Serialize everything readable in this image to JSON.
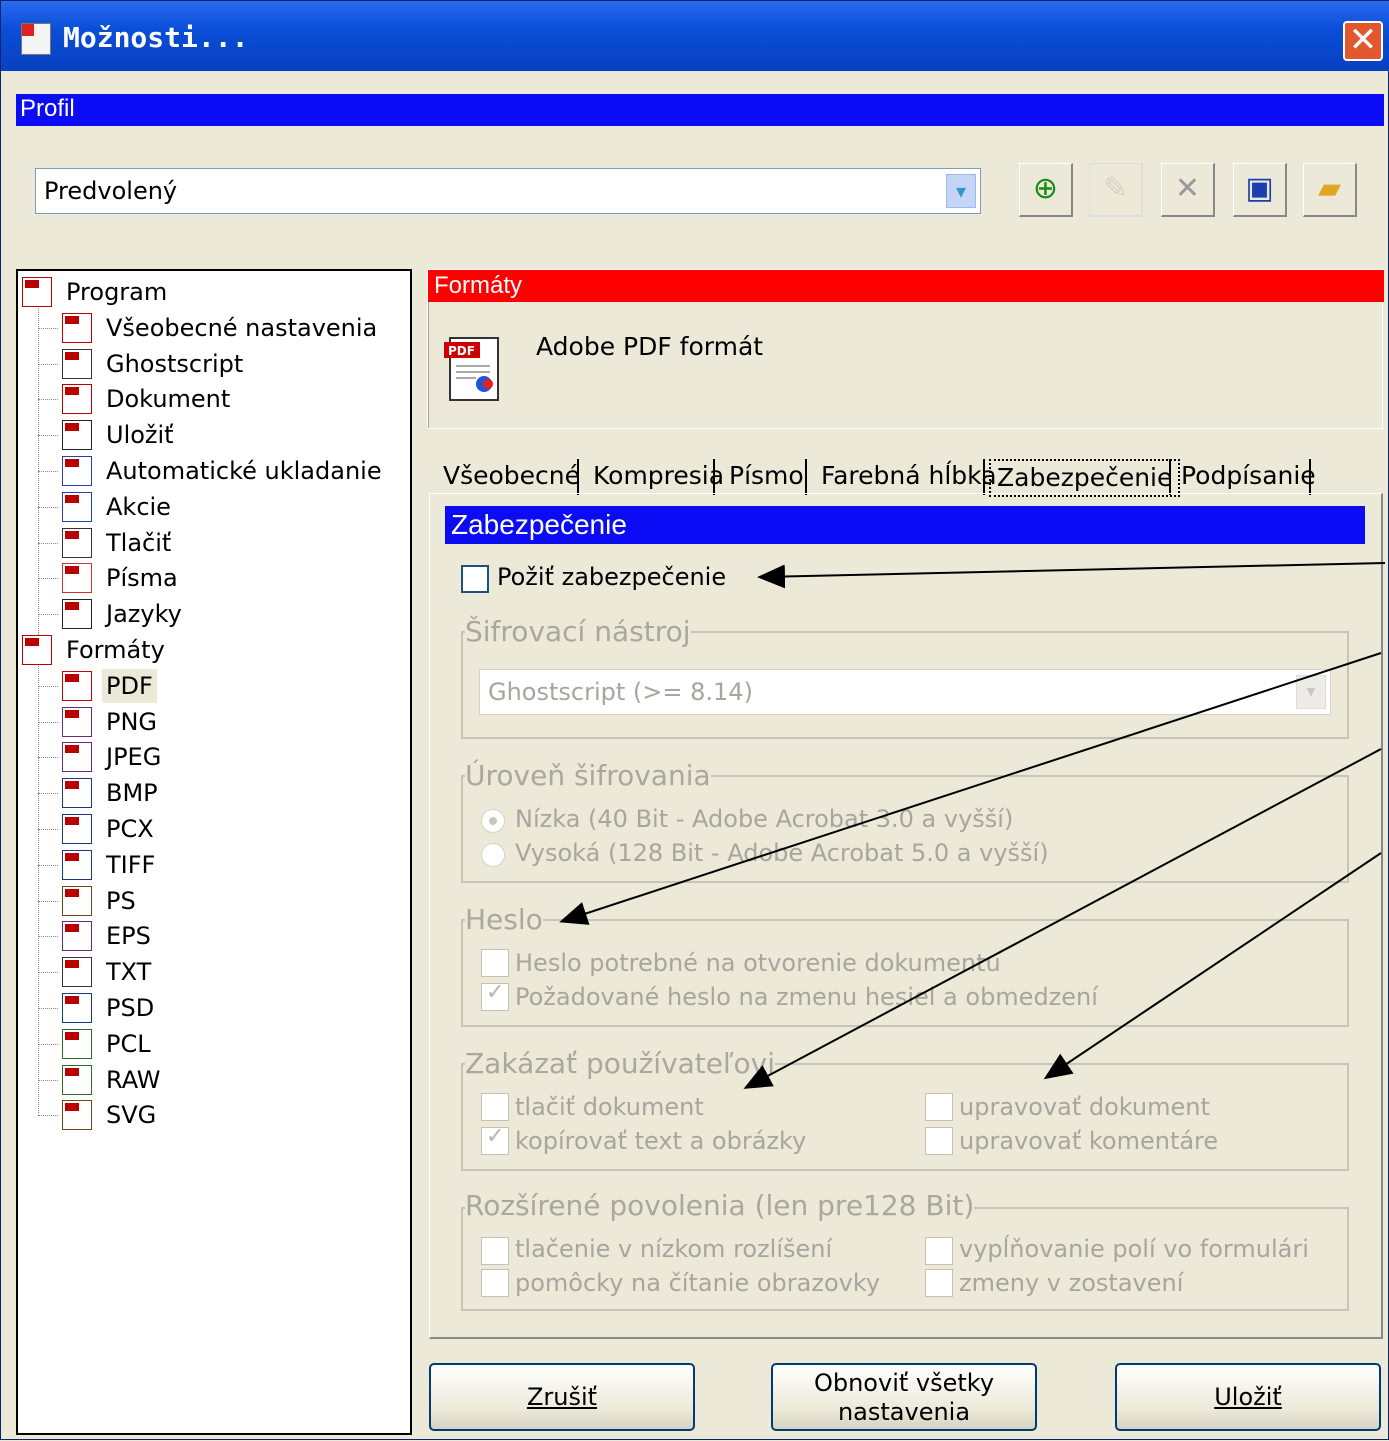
{
  "window": {
    "title": "Možnosti...",
    "close_label": "✕"
  },
  "profile": {
    "header": "Profil",
    "selected": "Predvolený",
    "toolbar_icons": [
      "add-profile-icon",
      "rename-profile-icon",
      "delete-profile-icon",
      "save-profile-icon",
      "open-profile-icon"
    ]
  },
  "tree": {
    "items": [
      {
        "label": "Program",
        "level": 0
      },
      {
        "label": "Všeobecné nastavenia",
        "level": 1
      },
      {
        "label": "Ghostscript",
        "level": 1
      },
      {
        "label": "Dokument",
        "level": 1
      },
      {
        "label": "Uložiť",
        "level": 1
      },
      {
        "label": "Automatické ukladanie",
        "level": 1
      },
      {
        "label": "Akcie",
        "level": 1
      },
      {
        "label": "Tlačiť",
        "level": 1
      },
      {
        "label": "Písma",
        "level": 1
      },
      {
        "label": "Jazyky",
        "level": 1
      },
      {
        "label": "Formáty",
        "level": 0
      },
      {
        "label": "PDF",
        "level": 1,
        "selected": true
      },
      {
        "label": "PNG",
        "level": 1
      },
      {
        "label": "JPEG",
        "level": 1
      },
      {
        "label": "BMP",
        "level": 1
      },
      {
        "label": "PCX",
        "level": 1
      },
      {
        "label": "TIFF",
        "level": 1
      },
      {
        "label": "PS",
        "level": 1
      },
      {
        "label": "EPS",
        "level": 1
      },
      {
        "label": "TXT",
        "level": 1
      },
      {
        "label": "PSD",
        "level": 1
      },
      {
        "label": "PCL",
        "level": 1
      },
      {
        "label": "RAW",
        "level": 1
      },
      {
        "label": "SVG",
        "level": 1
      }
    ]
  },
  "formats": {
    "header": "Formáty",
    "name": "Adobe PDF formát",
    "icon_label": "PDF"
  },
  "tabs": [
    "Všeobecné",
    "Kompresia",
    "Písmo",
    "Farebná hĺbka",
    "Zabezpečenie",
    "Podpísanie"
  ],
  "active_tab": "Zabezpečenie",
  "security": {
    "header": "Zabezpečenie",
    "use_security": {
      "label": "Požiť zabezpečenie",
      "checked": false
    },
    "encryptor": {
      "title": "Šifrovací nástroj",
      "value": "Ghostscript (>= 8.14)"
    },
    "level": {
      "title": "Úroveň šifrovania",
      "low": "Nízka (40 Bit - Adobe Acrobat 3.0 a vyšší)",
      "high": "Vysoká (128 Bit - Adobe Acrobat 5.0 a vyšší)",
      "selected": "low"
    },
    "password": {
      "title": "Heslo",
      "open_doc": "Heslo potrebné na otvorenie dokumentu",
      "change_perm": "Požadované heslo na zmenu hesiel a obmedzení",
      "open_doc_checked": false,
      "change_perm_checked": true
    },
    "disallow": {
      "title": "Zakázať používateľovi",
      "print": "tlačiť dokument",
      "copy": "kopírovať text a obrázky",
      "modify": "upravovať dokument",
      "comments": "upravovať komentáre",
      "print_checked": false,
      "copy_checked": true,
      "modify_checked": false,
      "comments_checked": false
    },
    "extended": {
      "title": "Rozšírené povolenia (len pre128 Bit)",
      "lowres": "tlačenie v nízkom rozlíšení",
      "screenreader": "pomôcky na čítanie obrazovky",
      "fillform": "vypĺňovanie polí vo formulári",
      "assembly": "zmeny v zostavení"
    }
  },
  "buttons": {
    "cancel": "Zrušiť",
    "reset_line1": "Obnoviť všetky",
    "reset_line2": "nastavenia",
    "save": "Uložiť"
  }
}
